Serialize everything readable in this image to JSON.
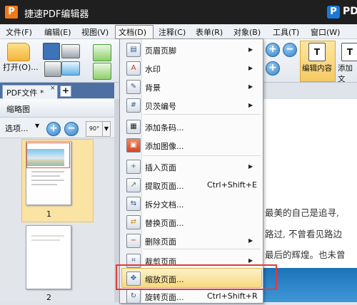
{
  "window": {
    "app_logo": "P",
    "title": "捷速PDF编辑器",
    "brand_logo": "P",
    "brand_text": "PDF"
  },
  "menubar": {
    "items": [
      "文件(F)",
      "编辑(E)",
      "视图(V)",
      "文档(D)",
      "注释(C)",
      "表单(R)",
      "对象(B)",
      "工具(T)",
      "窗口(W)"
    ]
  },
  "toolbar": {
    "open_label": "打开(O)...",
    "edit_content_label": "编辑内容",
    "add_text_label": "添加文"
  },
  "tabs": {
    "doc_tab": "PDF文件 *",
    "close_glyph": "×",
    "add_glyph": "+"
  },
  "panel": {
    "title": "缩略图",
    "options_label": "选项...",
    "zoom_in": "+",
    "zoom_out": "−",
    "rotate_label": "90°",
    "pages": [
      "1",
      "2"
    ]
  },
  "document": {
    "lines": [
      "最美的自己是追寻,",
      "路过, 不曾看见路边",
      "最后的辉煌。也未曾"
    ]
  },
  "dropdown": {
    "items": [
      {
        "label": "页眉页脚",
        "icon": "header-footer-icon",
        "glyph": "▤",
        "submenu": true,
        "shortcut": ""
      },
      {
        "label": "水印",
        "icon": "watermark-icon",
        "glyph": "A",
        "submenu": true,
        "shortcut": ""
      },
      {
        "label": "背景",
        "icon": "background-icon",
        "glyph": "✎",
        "submenu": true,
        "shortcut": ""
      },
      {
        "label": "贝茨编号",
        "icon": "bates-number-icon",
        "glyph": "#",
        "submenu": true,
        "shortcut": ""
      },
      {
        "label": "添加条码...",
        "icon": "barcode-icon",
        "glyph": "▦",
        "submenu": false,
        "shortcut": ""
      },
      {
        "label": "添加图像...",
        "icon": "add-image-icon",
        "glyph": "▣",
        "submenu": false,
        "shortcut": ""
      },
      {
        "label": "插入页面",
        "icon": "insert-page-icon",
        "glyph": "+",
        "submenu": true,
        "shortcut": ""
      },
      {
        "label": "提取页面...",
        "icon": "extract-page-icon",
        "glyph": "↗",
        "submenu": false,
        "shortcut": "Ctrl+Shift+E"
      },
      {
        "label": "拆分文档...",
        "icon": "split-document-icon",
        "glyph": "⇆",
        "submenu": false,
        "shortcut": ""
      },
      {
        "label": "替换页面...",
        "icon": "replace-page-icon",
        "glyph": "⇄",
        "submenu": false,
        "shortcut": ""
      },
      {
        "label": "删除页面",
        "icon": "delete-page-icon",
        "glyph": "−",
        "submenu": true,
        "shortcut": ""
      },
      {
        "label": "裁剪页面",
        "icon": "crop-page-icon",
        "glyph": "⌗",
        "submenu": true,
        "shortcut": ""
      },
      {
        "label": "缩放页面...",
        "icon": "scale-page-icon",
        "glyph": "✥",
        "submenu": false,
        "shortcut": ""
      },
      {
        "label": "旋转页面...",
        "icon": "rotate-page-icon",
        "glyph": "↻",
        "submenu": false,
        "shortcut": "Ctrl+Shift+R"
      }
    ]
  },
  "colors": {
    "accent": "#f07a1a",
    "highlight": "#f7d97e",
    "annotation_red": "#e43a3a",
    "tab_bar": "#4d6fa2"
  }
}
